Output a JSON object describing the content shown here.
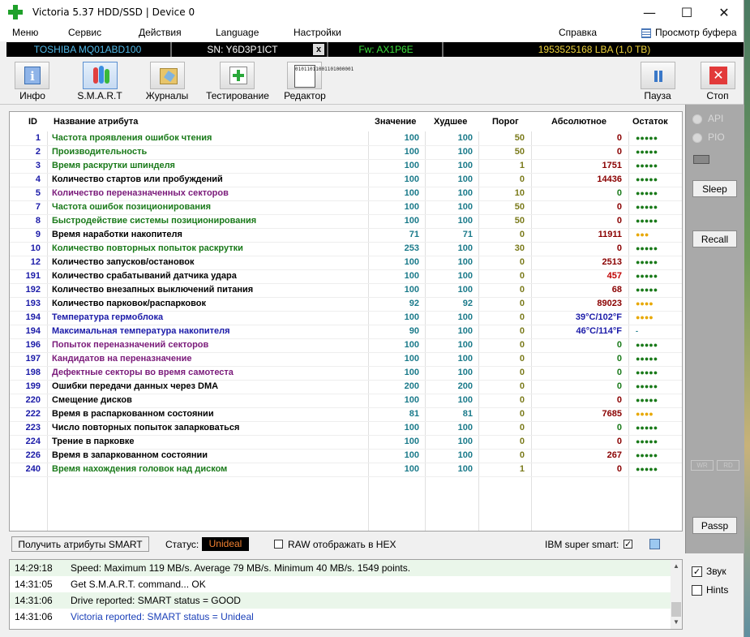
{
  "window": {
    "title": "Victoria 5.37 HDD/SSD | Device 0",
    "minimize": "—",
    "maximize": "☐",
    "close": "✕"
  },
  "menu": {
    "items": [
      "Меню",
      "Сервис",
      "Действия",
      "Language",
      "Настройки",
      "Справка"
    ],
    "buffer": "Просмотр буфера"
  },
  "device": {
    "model": "TOSHIBA MQ01ABD100",
    "serial": "SN: Y6D3P1ICT",
    "x": "x",
    "firmware": "Fw: AX1P6E",
    "capacity": "1953525168 LBA (1,0 TB)"
  },
  "toolbar": {
    "info": "Инфо",
    "smart": "S.M.A.R.T",
    "journals": "Журналы",
    "testing": "Тестирование",
    "editor": "Редактор",
    "pause": "Пауза",
    "stop": "Стоп",
    "editor_glyph": "01011011001101000001"
  },
  "table": {
    "headers": {
      "id": "ID",
      "name": "Название атрибута",
      "value": "Значение",
      "worst": "Худшее",
      "threshold": "Порог",
      "absolute": "Абсолютное",
      "remain": "Остаток"
    },
    "colors": {
      "green": "#1a7a1a",
      "black": "#000000",
      "purple": "#7a1a7a",
      "blue": "#1a1aa8",
      "teal": "#1a7a8a",
      "olive": "#7a7a1a",
      "darkred": "#8a0000",
      "red": "#c00000",
      "dotgreen": "#1a7a1a",
      "dotyellow": "#e8a800"
    },
    "rows": [
      {
        "id": "1",
        "name": "Частота проявления ошибок чтения",
        "value": "100",
        "worst": "100",
        "thr": "50",
        "abs": "0",
        "rem": "●●●●●",
        "nc": "green",
        "ac": "darkred",
        "rc": "dotgreen",
        "tc": "olive"
      },
      {
        "id": "2",
        "name": "Производительность",
        "value": "100",
        "worst": "100",
        "thr": "50",
        "abs": "0",
        "rem": "●●●●●",
        "nc": "green",
        "ac": "darkred",
        "rc": "dotgreen",
        "tc": "olive"
      },
      {
        "id": "3",
        "name": "Время раскрутки шпинделя",
        "value": "100",
        "worst": "100",
        "thr": "1",
        "abs": "1751",
        "rem": "●●●●●",
        "nc": "green",
        "ac": "darkred",
        "rc": "dotgreen",
        "tc": "olive"
      },
      {
        "id": "4",
        "name": "Количество стартов или пробуждений",
        "value": "100",
        "worst": "100",
        "thr": "0",
        "abs": "14436",
        "rem": "●●●●●",
        "nc": "black",
        "ac": "darkred",
        "rc": "dotgreen",
        "tc": "olive"
      },
      {
        "id": "5",
        "name": "Количество переназначенных секторов",
        "value": "100",
        "worst": "100",
        "thr": "10",
        "abs": "0",
        "rem": "●●●●●",
        "nc": "purple",
        "ac": "green",
        "rc": "dotgreen",
        "tc": "olive"
      },
      {
        "id": "7",
        "name": "Частота ошибок позиционирования",
        "value": "100",
        "worst": "100",
        "thr": "50",
        "abs": "0",
        "rem": "●●●●●",
        "nc": "green",
        "ac": "darkred",
        "rc": "dotgreen",
        "tc": "olive"
      },
      {
        "id": "8",
        "name": "Быстродействие системы позиционирования",
        "value": "100",
        "worst": "100",
        "thr": "50",
        "abs": "0",
        "rem": "●●●●●",
        "nc": "green",
        "ac": "darkred",
        "rc": "dotgreen",
        "tc": "olive"
      },
      {
        "id": "9",
        "name": "Время наработки накопителя",
        "value": "71",
        "worst": "71",
        "thr": "0",
        "abs": "11911",
        "rem": "●●●",
        "nc": "black",
        "ac": "darkred",
        "rc": "dotyellow",
        "tc": "olive"
      },
      {
        "id": "10",
        "name": "Количество повторных попыток раскрутки",
        "value": "253",
        "worst": "100",
        "thr": "30",
        "abs": "0",
        "rem": "●●●●●",
        "nc": "green",
        "ac": "darkred",
        "rc": "dotgreen",
        "tc": "olive"
      },
      {
        "id": "12",
        "name": "Количество запусков/остановок",
        "value": "100",
        "worst": "100",
        "thr": "0",
        "abs": "2513",
        "rem": "●●●●●",
        "nc": "black",
        "ac": "darkred",
        "rc": "dotgreen",
        "tc": "olive"
      },
      {
        "id": "191",
        "name": "Количество срабатываний датчика удара",
        "value": "100",
        "worst": "100",
        "thr": "0",
        "abs": "457",
        "rem": "●●●●●",
        "nc": "black",
        "ac": "red",
        "rc": "dotgreen",
        "tc": "olive"
      },
      {
        "id": "192",
        "name": "Количество внезапных выключений питания",
        "value": "100",
        "worst": "100",
        "thr": "0",
        "abs": "68",
        "rem": "●●●●●",
        "nc": "black",
        "ac": "darkred",
        "rc": "dotgreen",
        "tc": "olive"
      },
      {
        "id": "193",
        "name": "Количество парковок/распарковок",
        "value": "92",
        "worst": "92",
        "thr": "0",
        "abs": "89023",
        "rem": "●●●●",
        "nc": "black",
        "ac": "darkred",
        "rc": "dotyellow",
        "tc": "olive"
      },
      {
        "id": "194",
        "name": "Температура гермоблока",
        "value": "100",
        "worst": "100",
        "thr": "0",
        "abs": "39°C/102°F",
        "rem": "●●●●",
        "nc": "blue",
        "ac": "blue",
        "rc": "dotyellow",
        "tc": "olive"
      },
      {
        "id": "194",
        "name": "Максимальная температура накопителя",
        "value": "90",
        "worst": "100",
        "thr": "0",
        "abs": "46°C/114°F",
        "rem": "-",
        "nc": "blue",
        "ac": "blue",
        "rc": "teal",
        "tc": "olive"
      },
      {
        "id": "196",
        "name": "Попыток переназначений секторов",
        "value": "100",
        "worst": "100",
        "thr": "0",
        "abs": "0",
        "rem": "●●●●●",
        "nc": "purple",
        "ac": "green",
        "rc": "dotgreen",
        "tc": "olive"
      },
      {
        "id": "197",
        "name": "Кандидатов на переназначение",
        "value": "100",
        "worst": "100",
        "thr": "0",
        "abs": "0",
        "rem": "●●●●●",
        "nc": "purple",
        "ac": "green",
        "rc": "dotgreen",
        "tc": "olive"
      },
      {
        "id": "198",
        "name": "Дефектные секторы во время самотеста",
        "value": "100",
        "worst": "100",
        "thr": "0",
        "abs": "0",
        "rem": "●●●●●",
        "nc": "purple",
        "ac": "green",
        "rc": "dotgreen",
        "tc": "olive"
      },
      {
        "id": "199",
        "name": "Ошибки передачи данных через DMA",
        "value": "200",
        "worst": "200",
        "thr": "0",
        "abs": "0",
        "rem": "●●●●●",
        "nc": "black",
        "ac": "green",
        "rc": "dotgreen",
        "tc": "olive"
      },
      {
        "id": "220",
        "name": "Смещение дисков",
        "value": "100",
        "worst": "100",
        "thr": "0",
        "abs": "0",
        "rem": "●●●●●",
        "nc": "black",
        "ac": "darkred",
        "rc": "dotgreen",
        "tc": "olive"
      },
      {
        "id": "222",
        "name": "Время в распаркованном состоянии",
        "value": "81",
        "worst": "81",
        "thr": "0",
        "abs": "7685",
        "rem": "●●●●",
        "nc": "black",
        "ac": "darkred",
        "rc": "dotyellow",
        "tc": "olive"
      },
      {
        "id": "223",
        "name": "Число повторных попыток запарковаться",
        "value": "100",
        "worst": "100",
        "thr": "0",
        "abs": "0",
        "rem": "●●●●●",
        "nc": "black",
        "ac": "green",
        "rc": "dotgreen",
        "tc": "olive"
      },
      {
        "id": "224",
        "name": "Трение в парковке",
        "value": "100",
        "worst": "100",
        "thr": "0",
        "abs": "0",
        "rem": "●●●●●",
        "nc": "black",
        "ac": "darkred",
        "rc": "dotgreen",
        "tc": "olive"
      },
      {
        "id": "226",
        "name": "Время в запаркованном состоянии",
        "value": "100",
        "worst": "100",
        "thr": "0",
        "abs": "267",
        "rem": "●●●●●",
        "nc": "black",
        "ac": "darkred",
        "rc": "dotgreen",
        "tc": "olive"
      },
      {
        "id": "240",
        "name": "Время нахождения головок над диском",
        "value": "100",
        "worst": "100",
        "thr": "1",
        "abs": "0",
        "rem": "●●●●●",
        "nc": "green",
        "ac": "darkred",
        "rc": "dotgreen",
        "tc": "olive"
      }
    ]
  },
  "side": {
    "api": "API",
    "pio": "PIO",
    "sleep": "Sleep",
    "recall": "Recall",
    "passp": "Passp",
    "led1": "WR",
    "led2": "RD"
  },
  "status": {
    "get_button": "Получить атрибуты SMART",
    "status_label": "Статус:",
    "status_value": "Unideal",
    "raw_hex": "RAW отображать в HEX",
    "raw_hex_checked": false,
    "ibm": "IBM super smart:",
    "ibm_checked": true
  },
  "log": [
    {
      "time": "14:29:18",
      "msg": "Speed: Maximum 119 MB/s. Average 79 MB/s. Minimum 40 MB/s. 1549 points.",
      "color": "#000000",
      "bg": "#eaf6ea"
    },
    {
      "time": "14:31:05",
      "msg": "Get S.M.A.R.T. command... OK",
      "color": "#000000",
      "bg": "#ffffff"
    },
    {
      "time": "14:31:06",
      "msg": "Drive reported: SMART status = GOOD",
      "color": "#000000",
      "bg": "#eaf6ea"
    },
    {
      "time": "14:31:06",
      "msg": "Victoria reported: SMART status = Unideal",
      "color": "#1a3fb8",
      "bg": "#ffffff"
    }
  ],
  "options": {
    "sound": "Звук",
    "sound_checked": true,
    "hints": "Hints",
    "hints_checked": false
  }
}
